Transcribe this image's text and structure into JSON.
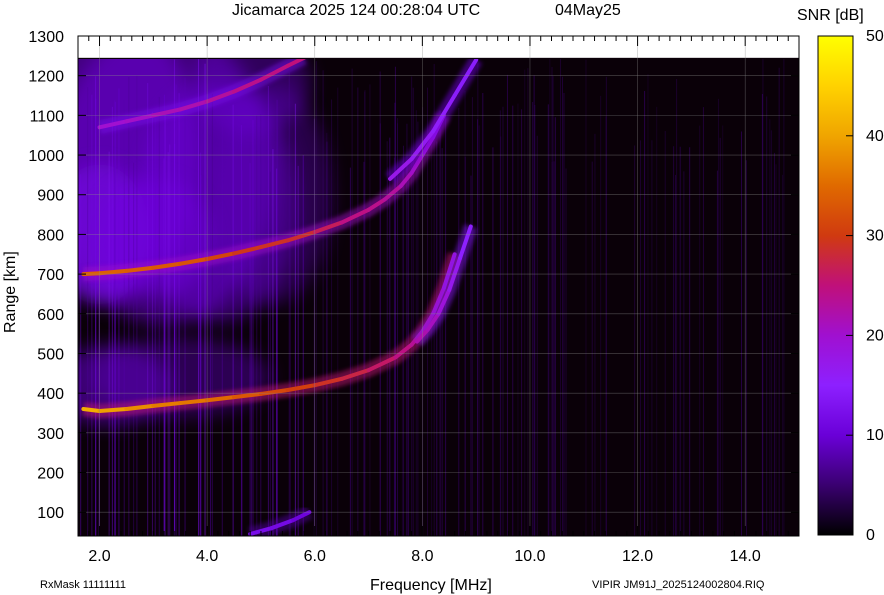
{
  "header": {
    "title": "Jicamarca 2025 124 00:28:04 UTC",
    "date": "04May25"
  },
  "footer": {
    "rx_mask": "RxMask 11111111",
    "file": "VIPIR  JM91J_2025124002804.RIQ"
  },
  "chart_data": {
    "type": "heatmap",
    "title": "Jicamarca 2025 124 00:28:04 UTC",
    "xlabel": "Frequency [MHz]",
    "ylabel": "Range [km]",
    "xlim": [
      1.6,
      15.0
    ],
    "ylim": [
      40,
      1300
    ],
    "data_range_max_km": 1245,
    "x_ticks": [
      "2.0",
      "4.0",
      "6.0",
      "8.0",
      "10.0",
      "12.0",
      "14.0"
    ],
    "x_tick_values": [
      2.0,
      4.0,
      6.0,
      8.0,
      10.0,
      12.0,
      14.0
    ],
    "y_ticks": [
      "100",
      "200",
      "300",
      "400",
      "500",
      "600",
      "700",
      "800",
      "900",
      "1000",
      "1100",
      "1200",
      "1300"
    ],
    "y_tick_values": [
      100,
      200,
      300,
      400,
      500,
      600,
      700,
      800,
      900,
      1000,
      1100,
      1200,
      1300
    ],
    "grid": true,
    "colorbar": {
      "label": "SNR [dB]",
      "min": 0,
      "max": 50,
      "ticks": [
        "0",
        "10",
        "20",
        "30",
        "40",
        "50"
      ],
      "tick_values": [
        0,
        10,
        20,
        30,
        40,
        50
      ],
      "colors": [
        "#000000",
        "#3a0070",
        "#6a00d8",
        "#8d20ff",
        "#a010d0",
        "#c0107a",
        "#d03a10",
        "#e06a00",
        "#f0a500",
        "#ffd200",
        "#ffff00"
      ]
    },
    "traces": [
      {
        "name": "",
        "x": [
          1.7,
          2.0,
          2.5,
          3.0,
          3.5,
          4.0,
          4.5,
          5.0,
          5.5,
          6.0,
          6.5,
          7.0,
          7.5,
          7.8,
          8.0,
          8.2,
          8.4,
          8.6
        ],
        "y": [
          360,
          355,
          360,
          368,
          375,
          382,
          390,
          398,
          408,
          420,
          436,
          458,
          490,
          522,
          555,
          600,
          665,
          750
        ],
        "snr": [
          42,
          40,
          39,
          37,
          36,
          36,
          34,
          32,
          31,
          30,
          28,
          27,
          25,
          24,
          23,
          22,
          20,
          18
        ]
      },
      {
        "name": "",
        "x": [
          7.9,
          8.1,
          8.3,
          8.5,
          8.7,
          8.9
        ],
        "y": [
          530,
          560,
          600,
          660,
          740,
          820
        ],
        "snr": [
          22,
          22,
          20,
          18,
          16,
          14
        ]
      },
      {
        "name": "",
        "x": [
          1.7,
          2.0,
          2.5,
          3.0,
          3.5,
          4.0,
          4.5,
          5.0,
          5.5,
          6.0,
          6.5,
          7.0,
          7.3,
          7.6,
          7.8,
          8.0,
          8.2,
          8.4
        ],
        "y": [
          700,
          702,
          708,
          716,
          726,
          738,
          752,
          768,
          785,
          806,
          830,
          862,
          888,
          922,
          955,
          1000,
          1045,
          1100
        ],
        "snr": [
          34,
          34,
          34,
          33,
          33,
          32,
          30,
          29,
          29,
          28,
          25,
          24,
          24,
          22,
          21,
          20,
          19,
          17
        ]
      },
      {
        "name": "",
        "x": [
          7.4,
          7.8,
          8.2,
          8.6,
          9.0
        ],
        "y": [
          940,
          990,
          1060,
          1150,
          1240
        ],
        "snr": [
          18,
          17,
          16,
          15,
          14
        ]
      },
      {
        "name": "",
        "x": [
          2.0,
          2.5,
          3.0,
          3.5,
          4.0,
          4.5,
          5.0,
          5.5,
          5.8
        ],
        "y": [
          1070,
          1085,
          1100,
          1115,
          1135,
          1160,
          1190,
          1225,
          1245
        ],
        "snr": [
          20,
          20,
          21,
          22,
          22,
          24,
          24,
          25,
          25
        ]
      },
      {
        "name": "",
        "x": [
          4.8,
          5.2,
          5.6,
          5.9
        ],
        "y": [
          45,
          60,
          80,
          100
        ],
        "snr": [
          12,
          12,
          11,
          10
        ]
      }
    ]
  }
}
